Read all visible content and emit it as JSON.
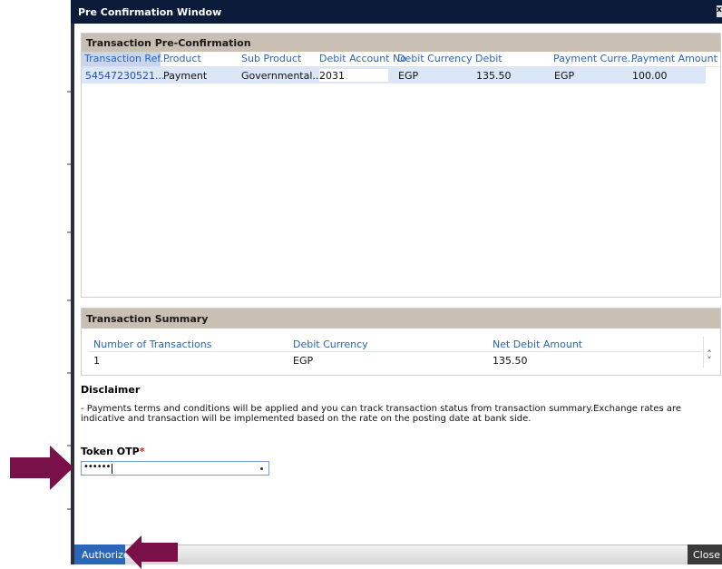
{
  "window": {
    "title": "Pre Confirmation Window"
  },
  "pre_confirmation": {
    "heading": "Transaction Pre-Confirmation",
    "columns": [
      "Transaction Ref...",
      "Product",
      "Sub Product",
      "Debit Account No",
      "Debit Currency",
      "Debit",
      "Payment Curre...",
      "Payment Amount"
    ],
    "row": {
      "transaction_ref": "54547230521...",
      "product": "Payment",
      "sub_product": "Governmental...",
      "debit_account_no": "2031",
      "debit_currency": "EGP",
      "debit": "135.50",
      "payment_currency": "EGP",
      "payment_amount": "100.00"
    }
  },
  "summary": {
    "heading": "Transaction Summary",
    "columns": [
      "Number of Transactions",
      "Debit Currency",
      "Net Debit Amount"
    ],
    "row": {
      "number_of_transactions": "1",
      "debit_currency": "EGP",
      "net_debit_amount": "135.50"
    }
  },
  "disclaimer": {
    "title": "Disclaimer",
    "text": "- Payments terms and conditions will be applied and you can track transaction status from transaction summary.Exchange rates are indicative and transaction will be implemented based on the rate on the posting date at bank side."
  },
  "token": {
    "label": "Token OTP",
    "required_mark": "*",
    "value_masked": "••••••"
  },
  "footer": {
    "authorize_label": "Authorize",
    "close_label": "Close"
  },
  "colors": {
    "title_bar": "#0b1b3a",
    "panel_header": "#c9bfb3",
    "link_blue": "#1f4fc0",
    "authorize_button": "#2b66b8",
    "annotation_arrow": "#7a1048"
  },
  "icons": {
    "arrow_right": "arrow-right-icon",
    "arrow_up": "arrow-up-icon",
    "scroll_updown": "chevron-updown-icon",
    "otp_clear": "clear-dot-icon"
  }
}
